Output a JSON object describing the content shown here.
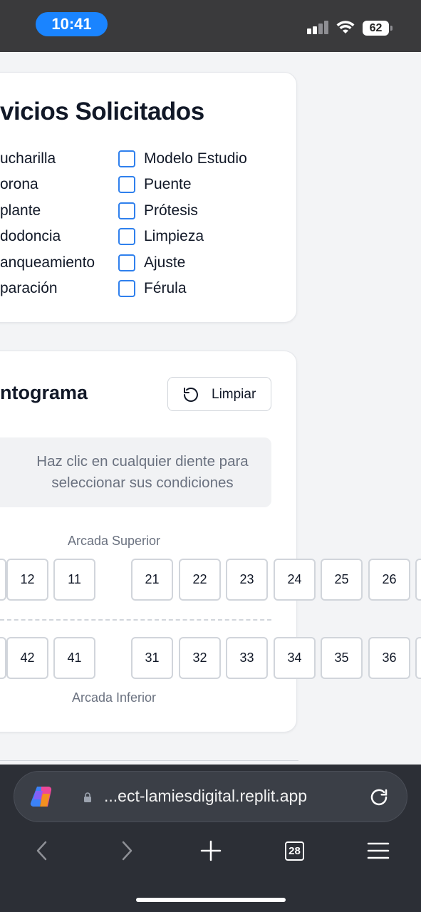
{
  "status_bar": {
    "time": "10:41",
    "battery": "62"
  },
  "services": {
    "title": "vicios Solicitados",
    "left_items": [
      "ucharilla",
      "orona",
      "plante",
      "dodoncia",
      "anqueamiento",
      "paración"
    ],
    "right_items": [
      "Modelo Estudio",
      "Puente",
      "Prótesis",
      "Limpieza",
      "Ajuste",
      "Férula"
    ]
  },
  "odontogram": {
    "title": "ntograma",
    "clear_label": "Limpiar",
    "hint_line1": "Haz clic en cualquier diente para",
    "hint_line2": "seleccionar sus condiciones",
    "upper_label": "Arcada Superior",
    "lower_label": "Arcada Inferior",
    "upper_teeth": [
      "12",
      "11",
      "21",
      "22",
      "23",
      "24",
      "25",
      "26"
    ],
    "lower_teeth": [
      "42",
      "41",
      "31",
      "32",
      "33",
      "34",
      "35",
      "36"
    ]
  },
  "browser": {
    "url": "...ect-lamiesdigital.replit.app",
    "tabs_count": "28"
  },
  "colors": {
    "checkbox_accent": "#2f80ed",
    "time_pill": "#1a84ff"
  }
}
